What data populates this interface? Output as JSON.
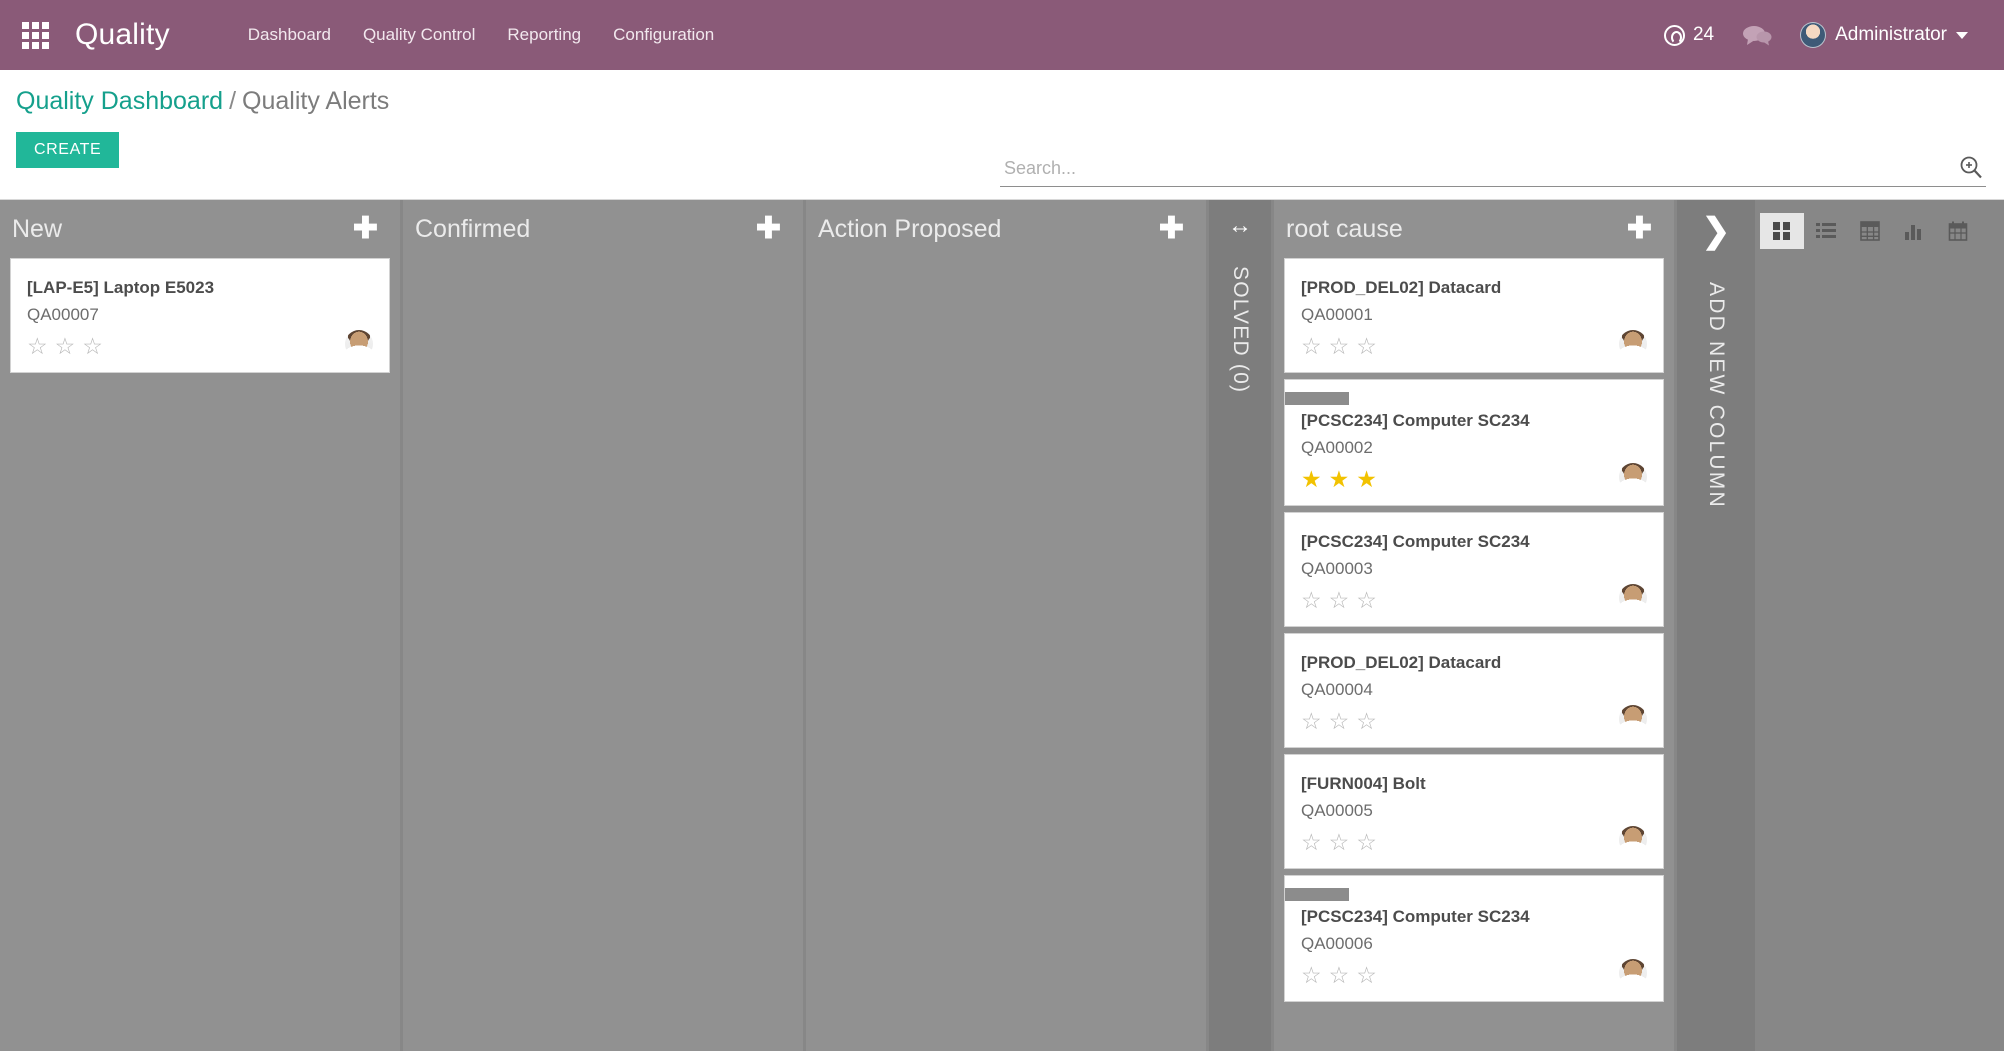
{
  "navbar": {
    "apps_icon": "apps-grid-icon",
    "brand": "Quality",
    "menu": [
      {
        "label": "Dashboard"
      },
      {
        "label": "Quality Control"
      },
      {
        "label": "Reporting"
      },
      {
        "label": "Configuration"
      }
    ],
    "mentions": {
      "icon": "at-mention-icon",
      "count": "24"
    },
    "messages_icon": "chat-bubble-icon",
    "user": {
      "name": "Administrator",
      "avatar_icon": "user-avatar",
      "caret_icon": "caret-down-icon"
    }
  },
  "control_panel": {
    "breadcrumb": {
      "parent": "Quality Dashboard",
      "separator": "/",
      "current": "Quality Alerts"
    },
    "create_label": "CREATE",
    "search": {
      "placeholder": "Search...",
      "value": "",
      "toggle_icon": "search-magnifier-icon"
    },
    "view_switcher": {
      "active": "kanban",
      "views": [
        {
          "key": "kanban",
          "icon": "kanban-view-icon",
          "active": true
        },
        {
          "key": "list",
          "icon": "list-view-icon",
          "active": false
        },
        {
          "key": "pivot",
          "icon": "pivot-view-icon",
          "active": false
        },
        {
          "key": "graph",
          "icon": "graph-view-icon",
          "active": false
        },
        {
          "key": "calendar",
          "icon": "calendar-view-icon",
          "active": false
        }
      ]
    }
  },
  "kanban": {
    "add_column": {
      "chevron_icon": "chevron-right-icon",
      "label": "ADD NEW COLUMN"
    },
    "columns": [
      {
        "title": "New",
        "add_icon": "plus-icon",
        "folded": false,
        "cards": [
          {
            "title": "[LAP-E5] Laptop E5023",
            "ref": "QA00007",
            "stars": 0,
            "ribbon": false,
            "avatar": "user-avatar"
          }
        ]
      },
      {
        "title": "Confirmed",
        "add_icon": "plus-icon",
        "folded": false,
        "cards": []
      },
      {
        "title": "Action Proposed",
        "add_icon": "plus-icon",
        "folded": false,
        "cards": []
      },
      {
        "title": "SOLVED (0)",
        "folded": true,
        "fold_icon": "arrows-horizontal-icon",
        "cards": []
      },
      {
        "title": "root cause",
        "add_icon": "plus-icon",
        "folded": false,
        "cards": [
          {
            "title": "[PROD_DEL02] Datacard",
            "ref": "QA00001",
            "stars": 0,
            "ribbon": false,
            "avatar": "user-avatar"
          },
          {
            "title": "[PCSC234] Computer SC234",
            "ref": "QA00002",
            "stars": 3,
            "ribbon": true,
            "avatar": "user-avatar"
          },
          {
            "title": "[PCSC234] Computer SC234",
            "ref": "QA00003",
            "stars": 0,
            "ribbon": false,
            "avatar": "user-avatar"
          },
          {
            "title": "[PROD_DEL02] Datacard",
            "ref": "QA00004",
            "stars": 0,
            "ribbon": false,
            "avatar": "user-avatar"
          },
          {
            "title": "[FURN004] Bolt",
            "ref": "QA00005",
            "stars": 0,
            "ribbon": false,
            "avatar": "user-avatar"
          },
          {
            "title": "[PCSC234] Computer SC234",
            "ref": "QA00006",
            "stars": 0,
            "ribbon": true,
            "avatar": "user-avatar"
          }
        ]
      }
    ]
  },
  "colors": {
    "navbar": "#8a5a78",
    "accent_teal": "#21b799",
    "breadcrumb_link": "#15a08c",
    "kanban_bg": "#878787",
    "column_bg": "#919191",
    "folded_bg": "#7d7d7d",
    "star_filled": "#f2c200",
    "card_bg": "#ffffff"
  }
}
